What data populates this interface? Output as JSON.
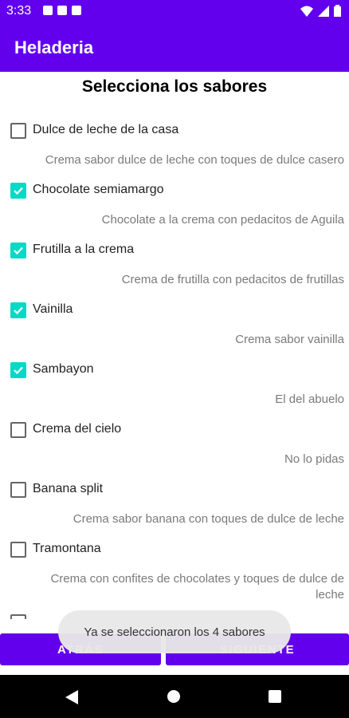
{
  "status_bar": {
    "time": "3:33"
  },
  "app_bar": {
    "title": "Heladeria"
  },
  "screen": {
    "title": "Selecciona los sabores"
  },
  "flavors": [
    {
      "name": "Dulce de leche de la casa",
      "description": "Crema sabor dulce de leche con toques de dulce casero",
      "checked": false
    },
    {
      "name": "Chocolate semiamargo",
      "description": "Chocolate a la crema con pedacitos de Aguila",
      "checked": true
    },
    {
      "name": "Frutilla a la crema",
      "description": "Crema de frutilla con pedacitos de frutillas",
      "checked": true
    },
    {
      "name": "Vainilla",
      "description": "Crema sabor vainilla",
      "checked": true
    },
    {
      "name": "Sambayon",
      "description": "El del abuelo",
      "checked": true
    },
    {
      "name": "Crema del cielo",
      "description": "No lo pidas",
      "checked": false
    },
    {
      "name": "Banana split",
      "description": "Crema sabor banana con toques de dulce de leche",
      "checked": false
    },
    {
      "name": "Tramontana",
      "description": "Crema con confites de chocolates y toques de dulce de leche",
      "checked": false
    }
  ],
  "buttons": {
    "back": "ATRÁS",
    "next": "SIGUIENTE"
  },
  "toast": {
    "message": "Ya se seleccionaron los 4 sabores"
  },
  "colors": {
    "primary": "#6200ee",
    "accent": "#03dac5"
  }
}
